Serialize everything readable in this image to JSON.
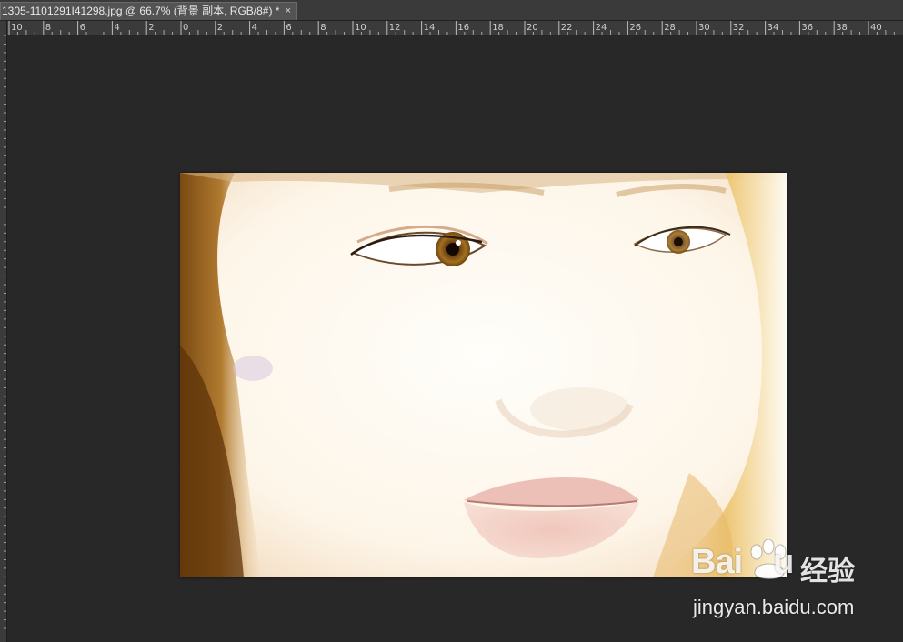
{
  "document_tab": {
    "title": "1305-1101291I41298.jpg @ 66.7% (背景 副本, RGB/8#) *",
    "close_glyph": "×"
  },
  "horizontal_ruler": {
    "labels": [
      "10",
      "8",
      "6",
      "4",
      "2",
      "0",
      "2",
      "4",
      "6",
      "8",
      "10",
      "12",
      "14",
      "16",
      "18",
      "20",
      "22",
      "24",
      "26",
      "28",
      "30",
      "32",
      "34",
      "36",
      "38",
      "40"
    ]
  },
  "canvas": {
    "background_color": "#282828",
    "image_content": "close-up portrait photo of a woman's face, overexposed bright skin"
  },
  "watermark": {
    "brand": "Bai",
    "brand_suffix": "u",
    "cn": "经验",
    "url": "jingyan.baidu.com",
    "paw_icon": "baidu-paw-icon"
  },
  "colors": {
    "app_background": "#282828",
    "tab_active": "#535353",
    "ruler": "#3b3b3b"
  }
}
